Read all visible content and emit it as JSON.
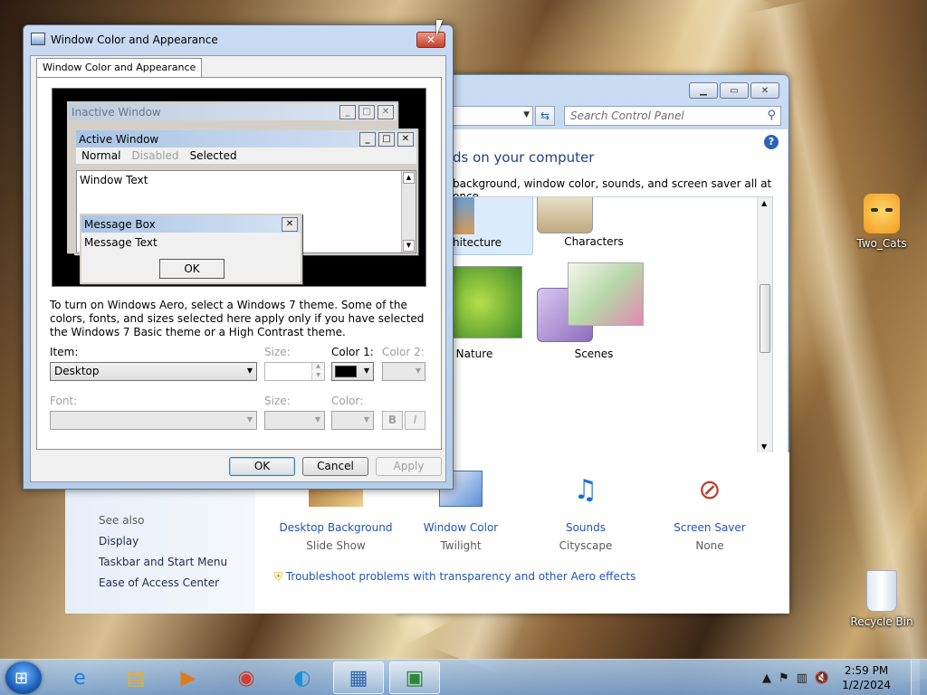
{
  "desktop": {
    "icons": [
      {
        "label": "Two_Cats"
      },
      {
        "label": "Recycle Bin"
      }
    ]
  },
  "control_panel": {
    "search_placeholder": "Search Control Panel",
    "heading": "ds on your computer",
    "subheading": "background, window color, sounds, and screen saver all at once.",
    "themes": [
      {
        "label": "hitecture"
      },
      {
        "label": "Characters"
      },
      {
        "label": "Nature"
      },
      {
        "label": "Scenes"
      }
    ],
    "bottom": [
      {
        "title": "Desktop Background",
        "value": "Slide Show"
      },
      {
        "title": "Window Color",
        "value": "Twilight"
      },
      {
        "title": "Sounds",
        "value": "Cityscape"
      },
      {
        "title": "Screen Saver",
        "value": "None"
      }
    ],
    "troubleshoot": "Troubleshoot problems with transparency and other Aero effects",
    "see_also": "See also",
    "side_links": [
      "Display",
      "Taskbar and Start Menu",
      "Ease of Access Center"
    ]
  },
  "dialog": {
    "title": "Window Color and Appearance",
    "tab": "Window Color and Appearance",
    "preview": {
      "inactive": "Inactive Window",
      "active": "Active Window",
      "menu_normal": "Normal",
      "menu_disabled": "Disabled",
      "menu_selected": "Selected",
      "window_text": "Window Text",
      "message_box": "Message Box",
      "message_text": "Message Text",
      "ok": "OK"
    },
    "info": "To turn on Windows Aero, select a Windows 7 theme.  Some of the colors, fonts, and sizes selected here apply only if you have selected the Windows 7 Basic theme or a High Contrast theme.",
    "item_label": "Item:",
    "item_value": "Desktop",
    "size_label": "Size:",
    "color1_label": "Color 1:",
    "color2_label": "Color 2:",
    "font_label": "Font:",
    "size2_label": "Size:",
    "color_label": "Color:",
    "bold": "B",
    "italic": "I",
    "buttons": {
      "ok": "OK",
      "cancel": "Cancel",
      "apply": "Apply"
    },
    "color1_value": "#000000"
  },
  "taskbar": {
    "time": "2:59 PM",
    "date": "1/2/2024"
  }
}
